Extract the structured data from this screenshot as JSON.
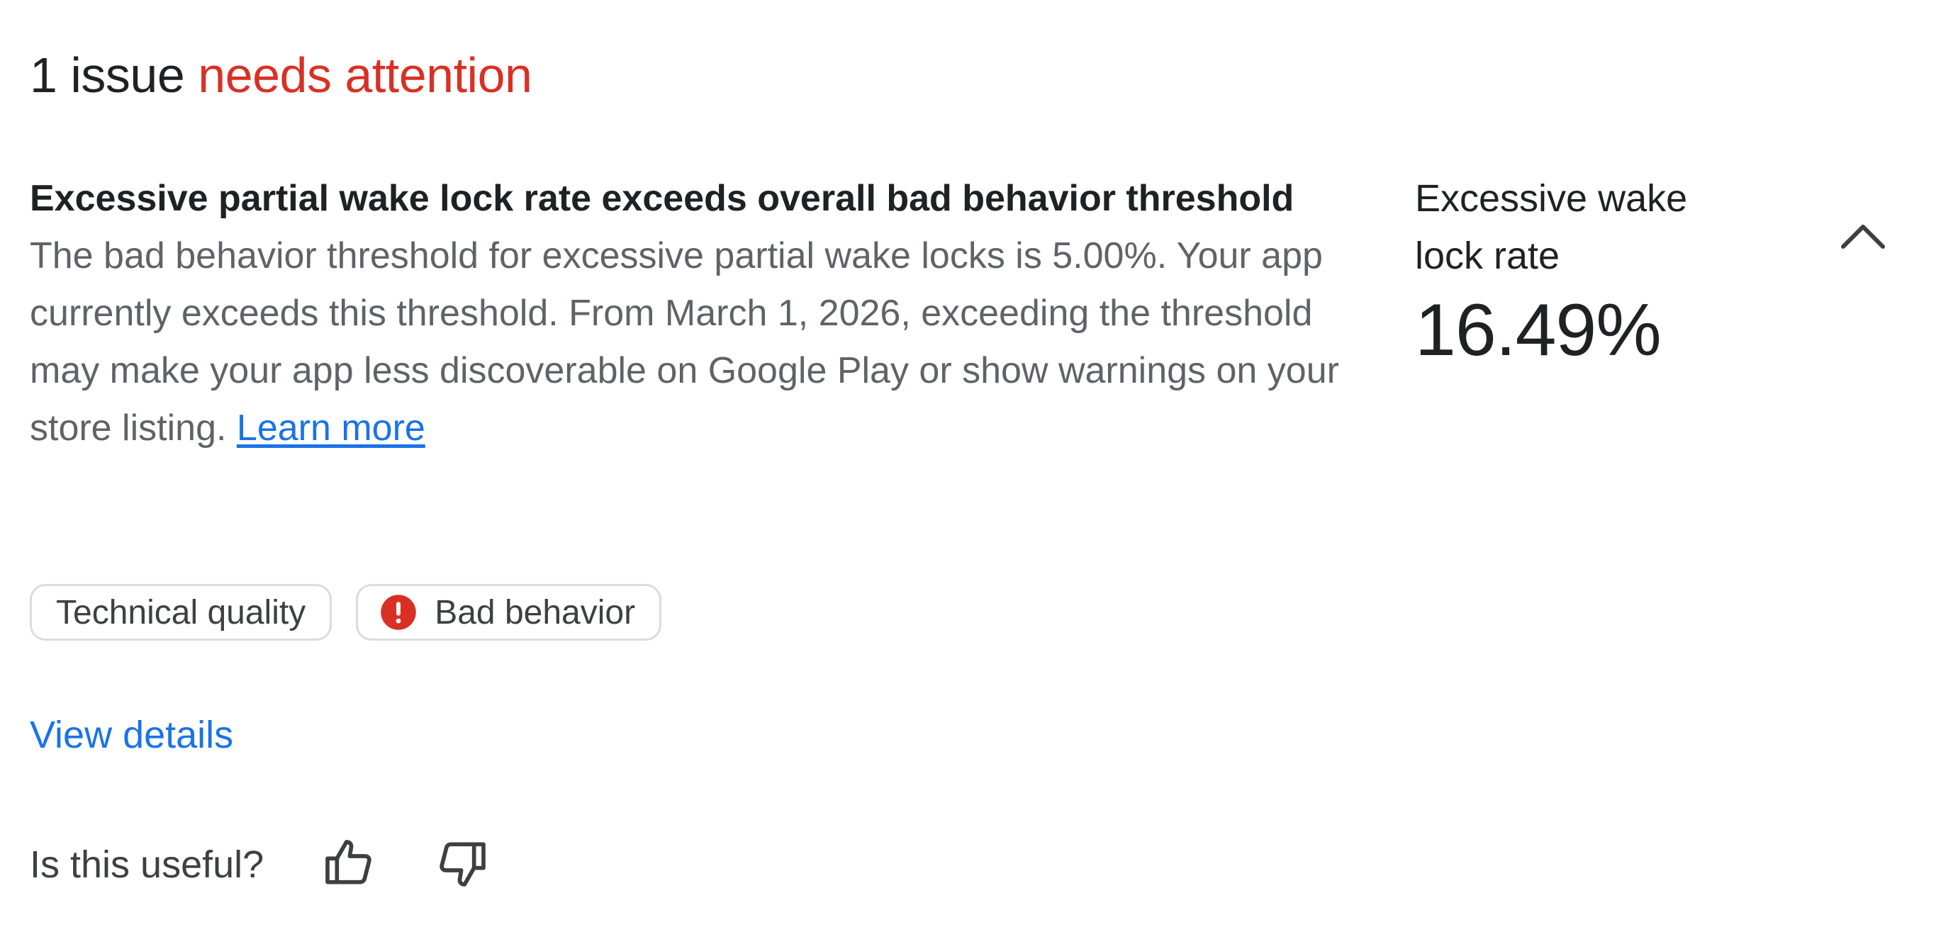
{
  "header": {
    "count_text": "1 issue",
    "status_text": "needs attention"
  },
  "issue": {
    "title": "Excessive partial wake lock rate exceeds overall bad behavior threshold",
    "description": "The bad behavior threshold for excessive partial wake locks is 5.00%. Your app currently exceeds this threshold. From March 1, 2026, exceeding the threshold may make your app less discoverable on Google Play or show warnings on your store listing.",
    "learn_more": "Learn more"
  },
  "chips": [
    {
      "label": "Technical quality",
      "icon": null
    },
    {
      "label": "Bad behavior",
      "icon": "error-icon"
    }
  ],
  "view_details": "View details",
  "feedback": {
    "question": "Is this useful?",
    "up_icon": "thumb-up-icon",
    "down_icon": "thumb-down-icon"
  },
  "metric": {
    "label": "Excessive wake lock rate",
    "value": "16.49%"
  },
  "collapse_icon": "chevron-up-icon",
  "colors": {
    "accent_red": "#d93025",
    "link_blue": "#1a73e8",
    "body_gray": "#5f6368",
    "text_dark": "#202124",
    "chip_border": "#dadce0"
  }
}
